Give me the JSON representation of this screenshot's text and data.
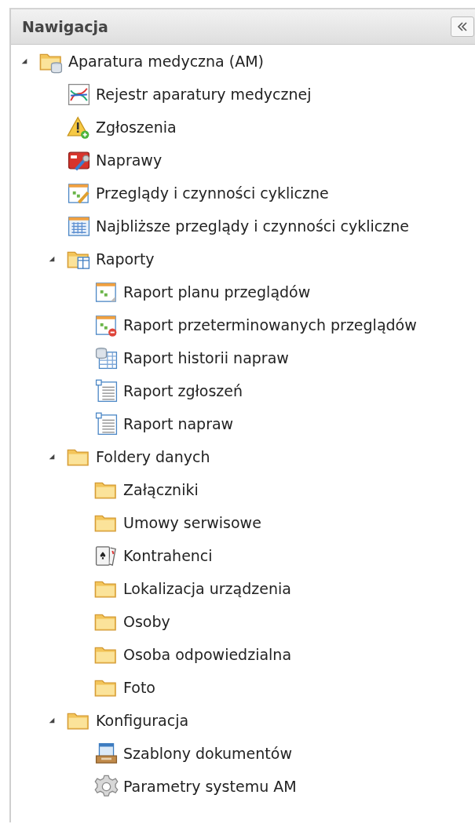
{
  "panel": {
    "title": "Nawigacja"
  },
  "tree": [
    {
      "label": "Aparatura medyczna (AM)",
      "kind": "folder-db",
      "expanded": true,
      "children": [
        {
          "label": "Rejestr aparatury medycznej",
          "kind": "chart"
        },
        {
          "label": "Zgłoszenia",
          "kind": "warning"
        },
        {
          "label": "Naprawy",
          "kind": "repair"
        },
        {
          "label": "Przeglądy i czynności cykliczne",
          "kind": "calendar-edit"
        },
        {
          "label": "Najbliższe przeglądy i czynności cykliczne",
          "kind": "calendar"
        },
        {
          "label": "Raporty",
          "kind": "folder-report",
          "expanded": true,
          "children": [
            {
              "label": "Raport planu przeglądów",
              "kind": "report-calendar"
            },
            {
              "label": "Raport przeterminowanych przeglądów",
              "kind": "report-overdue"
            },
            {
              "label": "Raport historii napraw",
              "kind": "report-db"
            },
            {
              "label": "Raport zgłoszeń",
              "kind": "list"
            },
            {
              "label": "Raport napraw",
              "kind": "list"
            }
          ]
        },
        {
          "label": "Foldery danych",
          "kind": "folder",
          "expanded": true,
          "children": [
            {
              "label": "Załączniki",
              "kind": "folder"
            },
            {
              "label": "Umowy serwisowe",
              "kind": "folder"
            },
            {
              "label": "Kontrahenci",
              "kind": "cards"
            },
            {
              "label": "Lokalizacja urządzenia",
              "kind": "folder"
            },
            {
              "label": "Osoby",
              "kind": "folder"
            },
            {
              "label": "Osoba odpowiedzialna",
              "kind": "folder"
            },
            {
              "label": "Foto",
              "kind": "folder"
            }
          ]
        },
        {
          "label": "Konfiguracja",
          "kind": "folder",
          "expanded": true,
          "children": [
            {
              "label": "Szablony dokumentów",
              "kind": "templates"
            },
            {
              "label": "Parametry systemu AM",
              "kind": "gear"
            }
          ]
        }
      ]
    }
  ]
}
